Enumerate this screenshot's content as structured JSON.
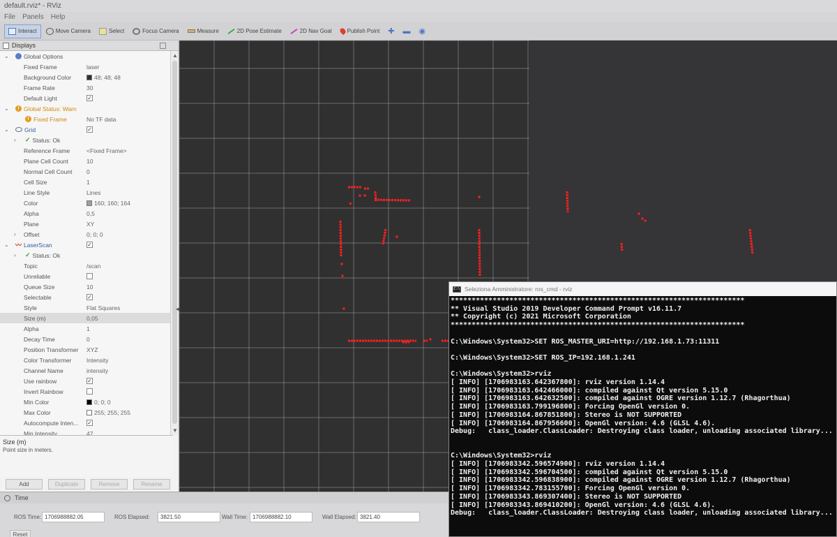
{
  "window": {
    "title": "default.rviz* - RViz"
  },
  "menu": [
    "File",
    "Panels",
    "Help"
  ],
  "toolbar": [
    {
      "label": "Interact",
      "icon": "interact-icon",
      "active": true
    },
    {
      "label": "Move Camera",
      "icon": "move-camera-icon"
    },
    {
      "label": "Select",
      "icon": "select-icon"
    },
    {
      "label": "Focus Camera",
      "icon": "focus-camera-icon"
    },
    {
      "label": "Measure",
      "icon": "measure-icon"
    },
    {
      "label": "2D Pose Estimate",
      "icon": "pose-estimate-icon"
    },
    {
      "label": "2D Nav Goal",
      "icon": "nav-goal-icon"
    },
    {
      "label": "Publish Point",
      "icon": "publish-point-icon"
    }
  ],
  "displays": {
    "title": "Displays",
    "rows": [
      {
        "name": "Global Options",
        "value": "",
        "level": 0,
        "expand": "v",
        "icon": "globe"
      },
      {
        "name": "Fixed Frame",
        "value": "laser",
        "level": 1
      },
      {
        "name": "Background Color",
        "value": "48; 48; 48",
        "level": 1,
        "swatch": "#303030"
      },
      {
        "name": "Frame Rate",
        "value": "30",
        "level": 1
      },
      {
        "name": "Default Light",
        "value": "",
        "level": 1,
        "check": true
      },
      {
        "name": "Global Status: Warn",
        "value": "",
        "level": 0,
        "expand": "v",
        "icon": "warn",
        "style": "warn"
      },
      {
        "name": "Fixed Frame",
        "value": "No TF data",
        "level": 1,
        "icon": "warn",
        "style": "warn"
      },
      {
        "name": "Grid",
        "value": "",
        "level": 0,
        "expand": "v",
        "icon": "grid",
        "style": "blue",
        "check": true
      },
      {
        "name": "Status: Ok",
        "value": "",
        "level": 1,
        "expand": ">",
        "icon": "check"
      },
      {
        "name": "Reference Frame",
        "value": "<Fixed Frame>",
        "level": 1
      },
      {
        "name": "Plane Cell Count",
        "value": "10",
        "level": 1
      },
      {
        "name": "Normal Cell Count",
        "value": "0",
        "level": 1
      },
      {
        "name": "Cell Size",
        "value": "1",
        "level": 1
      },
      {
        "name": "Line Style",
        "value": "Lines",
        "level": 1
      },
      {
        "name": "Color",
        "value": "160; 160; 164",
        "level": 1,
        "swatch": "#a0a0a4"
      },
      {
        "name": "Alpha",
        "value": "0,5",
        "level": 1
      },
      {
        "name": "Plane",
        "value": "XY",
        "level": 1
      },
      {
        "name": "Offset",
        "value": "0; 0; 0",
        "level": 1,
        "expand": ">"
      },
      {
        "name": "LaserScan",
        "value": "",
        "level": 0,
        "expand": "v",
        "icon": "laser",
        "style": "blue",
        "check": true
      },
      {
        "name": "Status: Ok",
        "value": "",
        "level": 1,
        "expand": ">",
        "icon": "check"
      },
      {
        "name": "Topic",
        "value": "/scan",
        "level": 1
      },
      {
        "name": "Unreliable",
        "value": "",
        "level": 1,
        "check": false
      },
      {
        "name": "Queue Size",
        "value": "10",
        "level": 1
      },
      {
        "name": "Selectable",
        "value": "",
        "level": 1,
        "check": true
      },
      {
        "name": "Style",
        "value": "Flat Squares",
        "level": 1
      },
      {
        "name": "Size (m)",
        "value": "0,05",
        "level": 1,
        "selected": true
      },
      {
        "name": "Alpha",
        "value": "1",
        "level": 1
      },
      {
        "name": "Decay Time",
        "value": "0",
        "level": 1
      },
      {
        "name": "Position Transformer",
        "value": "XYZ",
        "level": 1
      },
      {
        "name": "Color Transformer",
        "value": "Intensity",
        "level": 1
      },
      {
        "name": "Channel Name",
        "value": "intensity",
        "level": 1
      },
      {
        "name": "Use rainbow",
        "value": "",
        "level": 1,
        "check": true
      },
      {
        "name": "Invert Rainbow",
        "value": "",
        "level": 1,
        "check": false
      },
      {
        "name": "Min Color",
        "value": "0; 0; 0",
        "level": 1,
        "swatch": "#000000"
      },
      {
        "name": "Max Color",
        "value": "255; 255; 255",
        "level": 1,
        "swatch": "#ffffff"
      },
      {
        "name": "Autocompute Inten...",
        "value": "",
        "level": 1,
        "check": true
      },
      {
        "name": "Min Intensity",
        "value": "47",
        "level": 1
      }
    ],
    "help_title": "Size (m)",
    "help_text": "Point size in meters.",
    "buttons": [
      "Add",
      "Duplicate",
      "Remove",
      "Rename"
    ]
  },
  "time": {
    "title": "Time",
    "ros_time_label": "ROS Time:",
    "ros_time": "1706988882.05",
    "ros_elapsed_label": "ROS Elapsed:",
    "ros_elapsed": "3821.50",
    "wall_time_label": "Wall Time:",
    "wall_time": "1706988882.10",
    "wall_elapsed_label": "Wall Elapsed:",
    "wall_elapsed": "3821.40",
    "reset_label": "Reset"
  },
  "console": {
    "title": "Seleziona Amministratore: ros_cmd - rviz",
    "lines": [
      "**********************************************************************",
      "** Visual Studio 2019 Developer Command Prompt v16.11.7",
      "** Copyright (c) 2021 Microsoft Corporation",
      "**********************************************************************",
      "",
      "C:\\Windows\\System32>SET ROS_MASTER_URI=http://192.168.1.73:11311",
      "",
      "C:\\Windows\\System32>SET ROS_IP=192.168.1.241",
      "",
      "C:\\Windows\\System32>rviz",
      "[ INFO] [1706983163.642367800]: rviz version 1.14.4",
      "[ INFO] [1706983163.642466000]: compiled against Qt version 5.15.0",
      "[ INFO] [1706983163.642632500]: compiled against OGRE version 1.12.7 (Rhagorthua)",
      "[ INFO] [1706983163.799196800]: Forcing OpenGl version 0.",
      "[ INFO] [1706983164.867851800]: Stereo is NOT SUPPORTED",
      "[ INFO] [1706983164.867956600]: OpenGl version: 4.6 (GLSL 4.6).",
      "Debug:   class_loader.ClassLoader: Destroying class loader, unloading associated library...",
      "",
      "",
      "C:\\Windows\\System32>rviz",
      "[ INFO] [1706983342.596574900]: rviz version 1.14.4",
      "[ INFO] [1706983342.596704500]: compiled against Qt version 5.15.0",
      "[ INFO] [1706983342.596838900]: compiled against OGRE version 1.12.7 (Rhagorthua)",
      "[ INFO] [1706983342.783155700]: Forcing OpenGl version 0.",
      "[ INFO] [1706983343.869307400]: Stereo is NOT SUPPORTED",
      "[ INFO] [1706983343.869410200]: OpenGl version: 4.6 (GLSL 4.6).",
      "Debug:   class_loader.ClassLoader: Destroying class loader, unloading associated library..."
    ]
  },
  "colors": {
    "background": "#303030",
    "grid": "#a0a0a4",
    "laser": "#ff2020",
    "console_bg": "#0c0c0c"
  }
}
